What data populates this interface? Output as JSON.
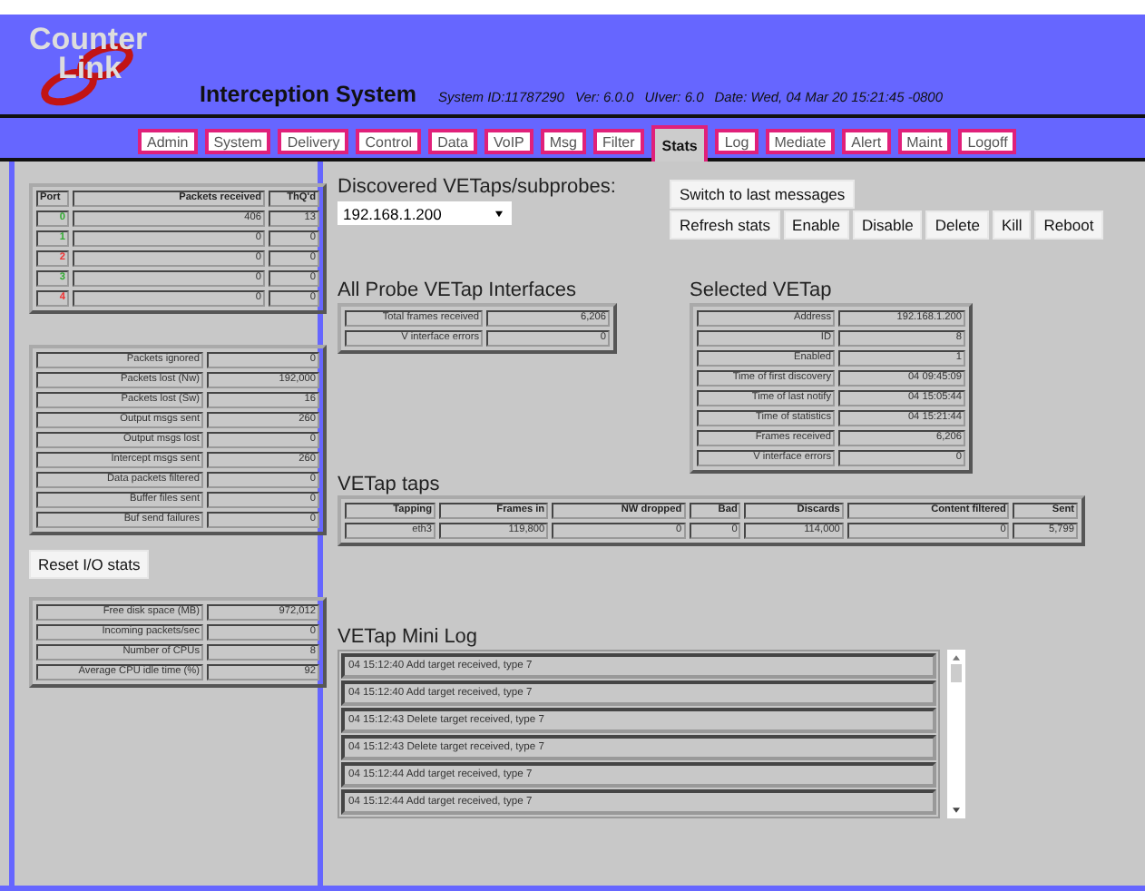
{
  "header": {
    "logo_top": "Counter",
    "logo_bottom": "Link",
    "title": "Interception System",
    "system_id": "System ID:11787290",
    "version": "Ver: 6.0.0",
    "uiver": "UIver: 6.0",
    "date": "Date: Wed, 04 Mar 20 15:21:45 -0800"
  },
  "tabs": [
    {
      "label": "Admin",
      "selected": false
    },
    {
      "label": "System",
      "selected": false
    },
    {
      "label": "Delivery",
      "selected": false
    },
    {
      "label": "Control",
      "selected": false
    },
    {
      "label": "Data",
      "selected": false
    },
    {
      "label": "VoIP",
      "selected": false
    },
    {
      "label": "Msg",
      "selected": false
    },
    {
      "label": "Filter",
      "selected": false
    },
    {
      "label": "Stats",
      "selected": true
    },
    {
      "label": "Log",
      "selected": false
    },
    {
      "label": "Mediate",
      "selected": false
    },
    {
      "label": "Alert",
      "selected": false
    },
    {
      "label": "Maint",
      "selected": false
    },
    {
      "label": "Logoff",
      "selected": false
    }
  ],
  "ports": {
    "columns": [
      "Port",
      "Packets received",
      "ThQ'd"
    ],
    "rows": [
      {
        "port": "0",
        "color": "#33aa33",
        "received": "406",
        "thqd": "13"
      },
      {
        "port": "1",
        "color": "#33aa33",
        "received": "0",
        "thqd": "0"
      },
      {
        "port": "2",
        "color": "#ee3333",
        "received": "0",
        "thqd": "0"
      },
      {
        "port": "3",
        "color": "#33aa33",
        "received": "0",
        "thqd": "0"
      },
      {
        "port": "4",
        "color": "#ee3333",
        "received": "0",
        "thqd": "0"
      }
    ]
  },
  "io_stats": [
    [
      "Packets ignored",
      "0"
    ],
    [
      "Packets lost (Nw)",
      "192,000"
    ],
    [
      "Packets lost (Sw)",
      "16"
    ],
    [
      "Output msgs sent",
      "260"
    ],
    [
      "Output msgs lost",
      "0"
    ],
    [
      "Intercept msgs sent",
      "260"
    ],
    [
      "Data packets filtered",
      "0"
    ],
    [
      "Buffer files sent",
      "0"
    ],
    [
      "Buf send failures",
      "0"
    ]
  ],
  "reset_button": "Reset I/O stats",
  "system_stats": [
    [
      "Free disk space (MB)",
      "972,012"
    ],
    [
      "Incoming packets/sec",
      "0"
    ],
    [
      "Number of CPUs",
      "8"
    ],
    [
      "Average CPU idle time (%)",
      "92"
    ]
  ],
  "discovered": {
    "label": "Discovered VETaps/subprobes:",
    "value": "192.168.1.200"
  },
  "switch_button": "Switch to last messages",
  "action_buttons": [
    "Refresh stats",
    "Enable",
    "Disable",
    "Delete",
    "Kill",
    "Reboot"
  ],
  "all_probe": {
    "title": "All Probe VETap Interfaces",
    "rows": [
      [
        "Total frames received",
        "6,206"
      ],
      [
        "V interface errors",
        "0"
      ]
    ]
  },
  "selected_vetap": {
    "title": "Selected VETap",
    "rows": [
      [
        "Address",
        "192.168.1.200"
      ],
      [
        "ID",
        "8"
      ],
      [
        "Enabled",
        "1"
      ],
      [
        "Time of first discovery",
        "04 09:45:09"
      ],
      [
        "Time of last notify",
        "04 15:05:44"
      ],
      [
        "Time of statistics",
        "04 15:21:44"
      ],
      [
        "Frames received",
        "6,206"
      ],
      [
        "V interface errors",
        "0"
      ]
    ]
  },
  "taps": {
    "title": "VETap taps",
    "columns": [
      "Tapping",
      "Frames in",
      "NW dropped",
      "Bad",
      "Discards",
      "Content filtered",
      "Sent"
    ],
    "rows": [
      [
        "eth3",
        "119,800",
        "0",
        "0",
        "114,000",
        "0",
        "5,799"
      ]
    ]
  },
  "mini_log": {
    "title": "VETap Mini Log",
    "entries": [
      "04 15:12:40 Add target received, type 7",
      "04 15:12:40 Add target received, type 7",
      "04 15:12:43 Delete target received, type 7",
      "04 15:12:43 Delete target received, type 7",
      "04 15:12:44 Add target received, type 7",
      "04 15:12:44 Add target received, type 7"
    ]
  }
}
